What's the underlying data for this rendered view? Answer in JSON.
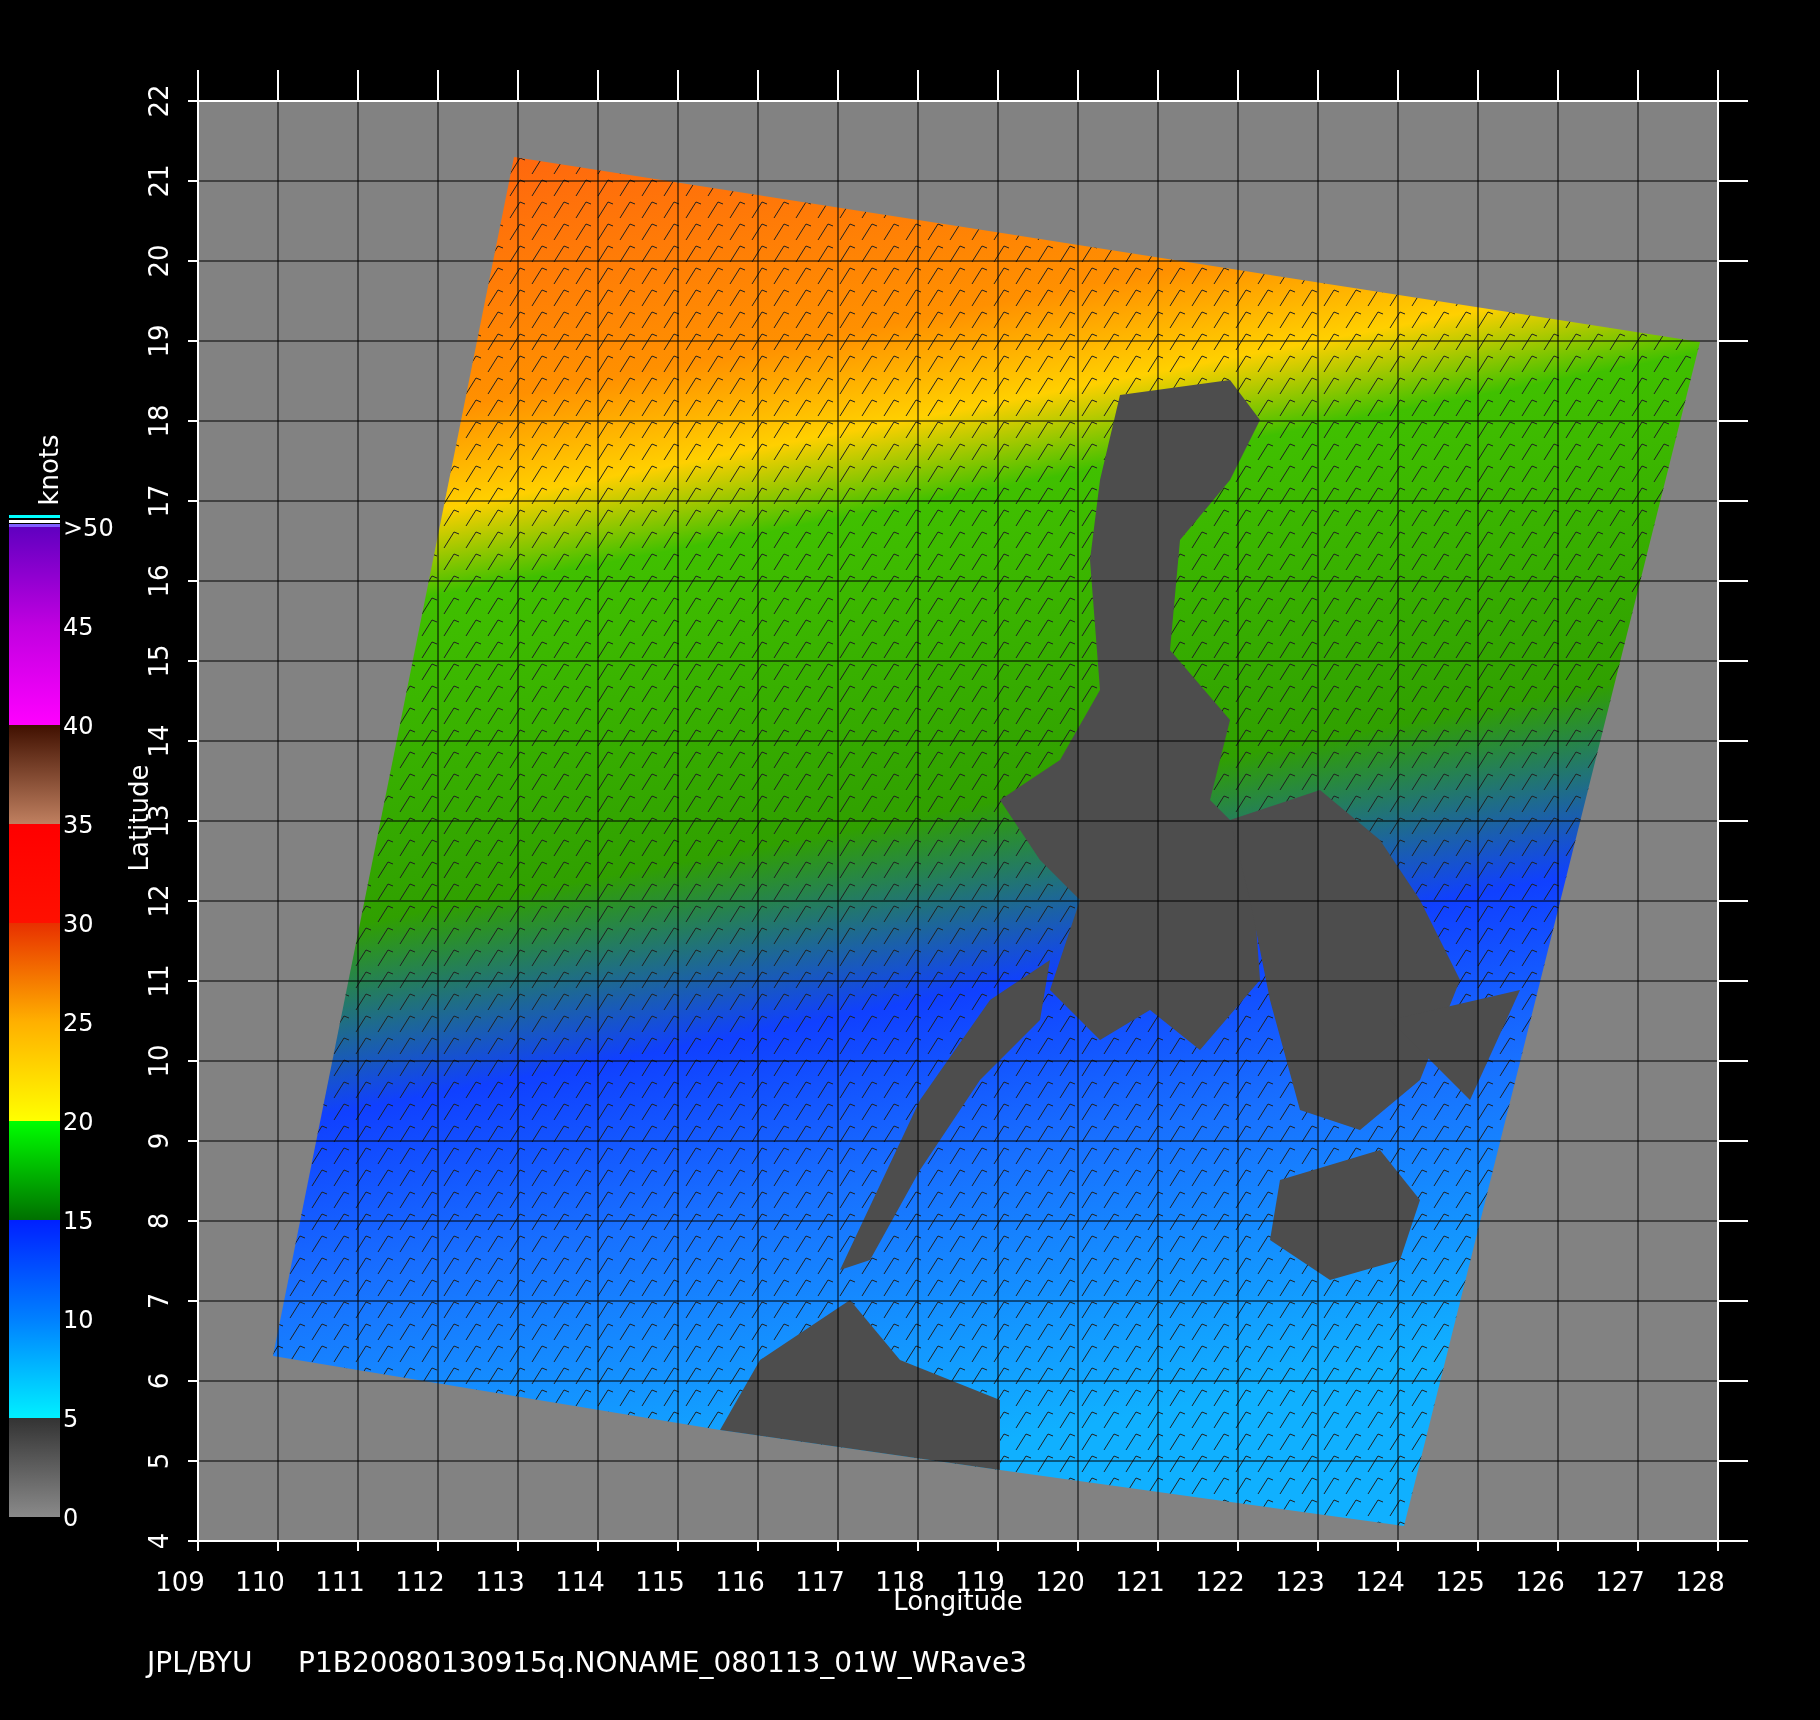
{
  "colorbar": {
    "title": "knots",
    "labels": [
      ">50",
      "45",
      "40",
      "35",
      "30",
      "25",
      "20",
      "15",
      "10",
      "5",
      "0"
    ]
  },
  "y_axis": {
    "label": "Latitude",
    "ticks": [
      "22",
      "21",
      "20",
      "19",
      "18",
      "17",
      "16",
      "15",
      "14",
      "13",
      "12",
      "11",
      "10",
      "9",
      "8",
      "7",
      "6",
      "5",
      "4"
    ]
  },
  "x_axis": {
    "label": "Longitude",
    "ticks": [
      "109",
      "110",
      "111",
      "112",
      "113",
      "114",
      "115",
      "116",
      "117",
      "118",
      "119",
      "120",
      "121",
      "122",
      "123",
      "124",
      "125",
      "126",
      "127",
      "128"
    ]
  },
  "footer": {
    "source": "JPL/BYU",
    "file": "P1B20080130915q.NONAME_080113_01W_WRave3"
  }
}
